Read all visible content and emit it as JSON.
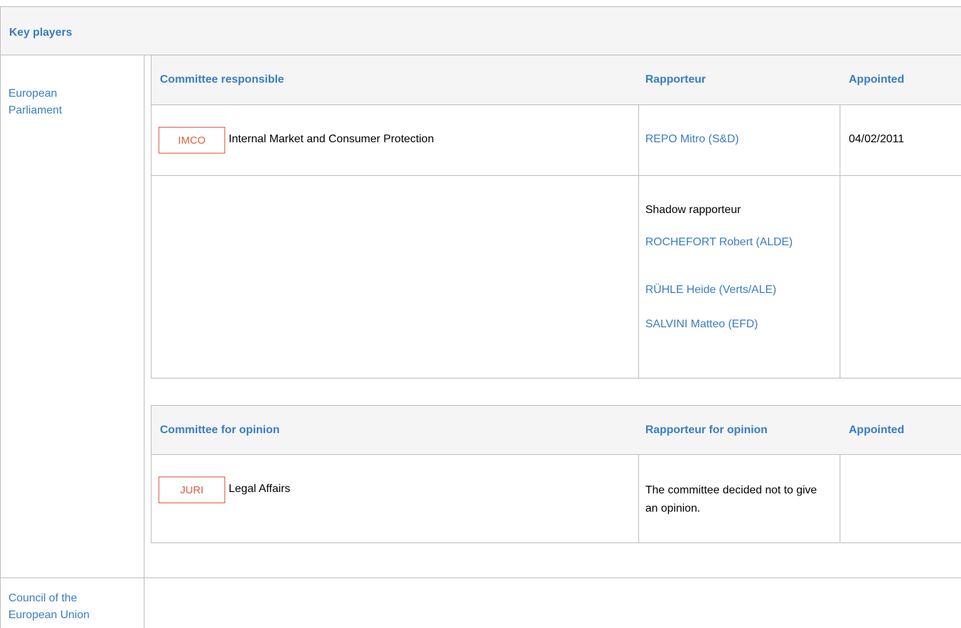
{
  "section": {
    "title": "Key players"
  },
  "institutions": {
    "ep": "European Parliament",
    "council": "Council of the European Union"
  },
  "responsible": {
    "headers": {
      "committee": "Committee responsible",
      "rapporteur": "Rapporteur",
      "appointed": "Appointed"
    },
    "committee": {
      "code": "IMCO",
      "name": "Internal Market and Consumer Protection"
    },
    "rapporteur": "REPO Mitro (S&D)",
    "appointed": "04/02/2011",
    "shadow": {
      "title": "Shadow rapporteur",
      "names": [
        "ROCHEFORT Robert (ALDE)",
        "RÜHLE Heide (Verts/ALE)",
        "SALVINI Matteo (EFD)"
      ]
    }
  },
  "opinion": {
    "headers": {
      "committee": "Committee for opinion",
      "rapporteur": "Rapporteur for opinion",
      "appointed": "Appointed"
    },
    "committee": {
      "code": "JURI",
      "name": "Legal Affairs"
    },
    "note": "The committee decided not to give an opinion."
  },
  "colors": {
    "link": "#3a7cc4",
    "badge": "#e05a43",
    "header_bg": "#f5f5f5",
    "border": "#bdbdbd"
  }
}
